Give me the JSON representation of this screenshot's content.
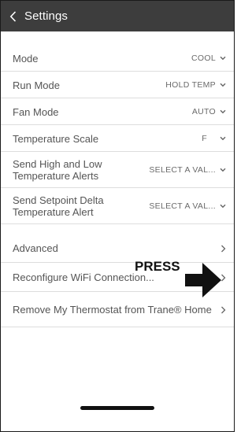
{
  "header": {
    "title": "Settings",
    "back_icon": "chevron-left-icon"
  },
  "settings": [
    {
      "label": "Mode",
      "value": "COOL"
    },
    {
      "label": "Run Mode",
      "value": "HOLD TEMP"
    },
    {
      "label": "Fan Mode",
      "value": "AUTO"
    },
    {
      "label": "Temperature Scale",
      "value": "F"
    },
    {
      "label_line1": "Send High and Low",
      "label_line2": "Temperature Alerts",
      "value": "SELECT A VAL..."
    },
    {
      "label_line1": "Send Setpoint Delta",
      "label_line2": "Temperature Alert",
      "value": "SELECT A VAL..."
    }
  ],
  "links": [
    {
      "label": "Advanced"
    },
    {
      "label": "Reconfigure WiFi Connection..."
    },
    {
      "label": "Remove My Thermostat from Trane® Home"
    }
  ],
  "annotation": {
    "text": "PRESS"
  },
  "colors": {
    "header_bg": "#3d3d3d",
    "divider": "#dddddd",
    "text": "#555555"
  }
}
